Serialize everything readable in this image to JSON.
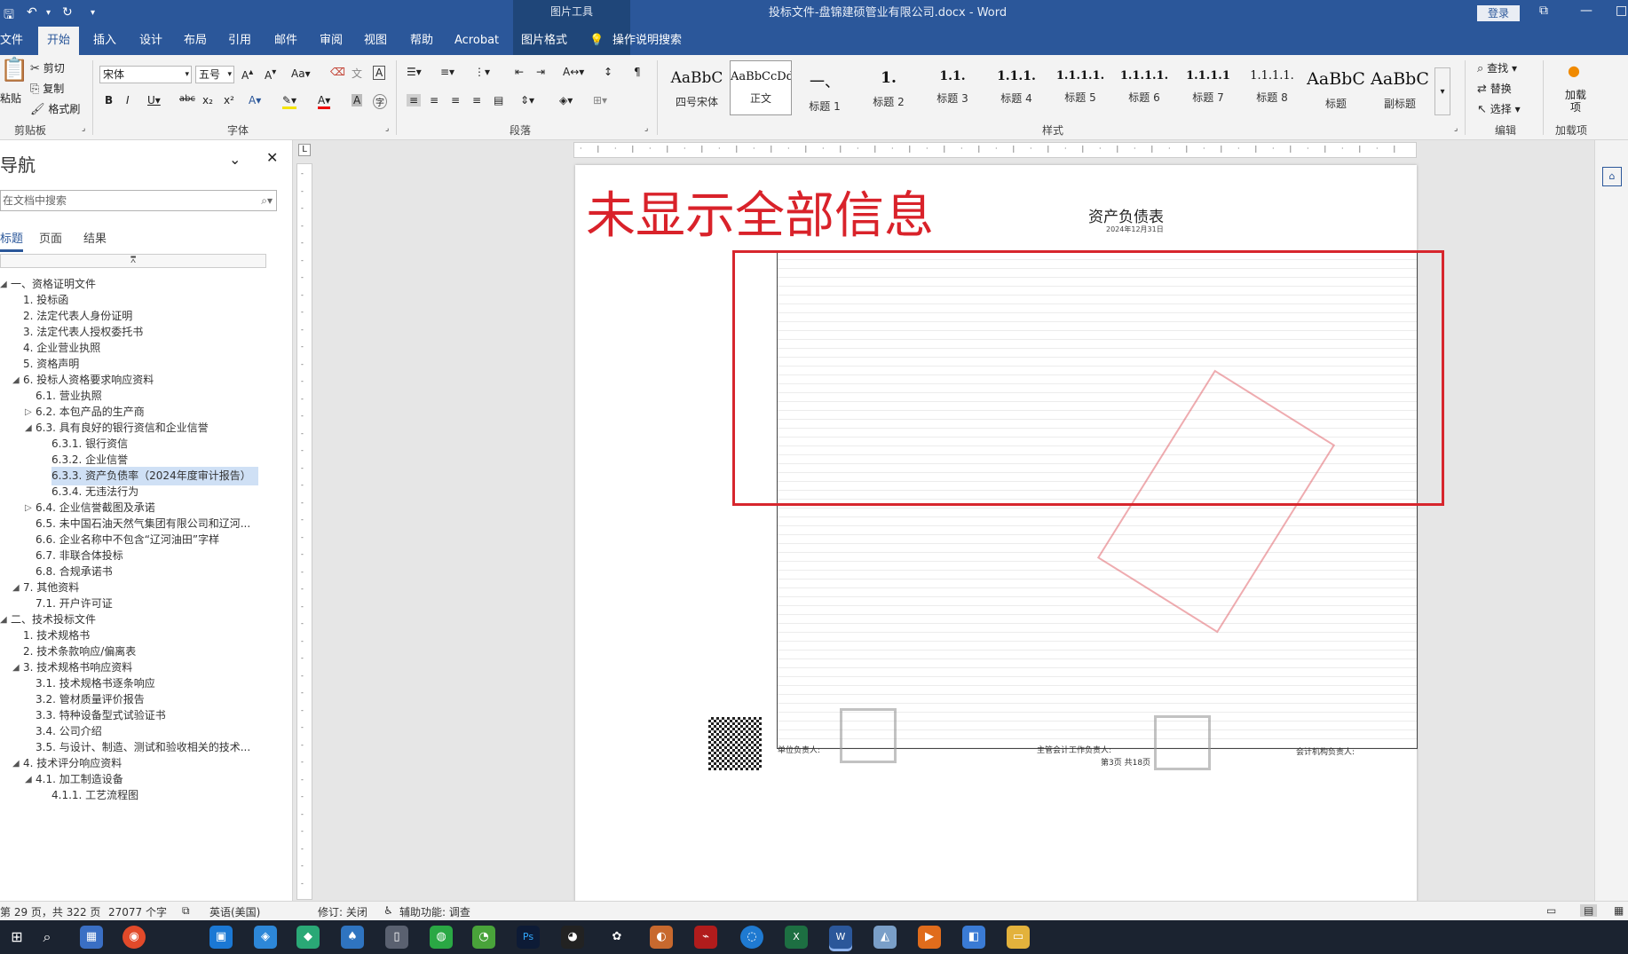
{
  "titlebar": {
    "context_tools": "图片工具",
    "doc_title": "投标文件-盘锦建硕管业有限公司.docx  -  Word",
    "login": "登录"
  },
  "tabs": [
    "文件",
    "开始",
    "插入",
    "设计",
    "布局",
    "引用",
    "邮件",
    "审阅",
    "视图",
    "帮助",
    "Acrobat",
    "图片格式"
  ],
  "search_tell": "操作说明搜索",
  "ribbon": {
    "clipboard": {
      "paste": "粘贴",
      "cut": "剪切",
      "copy": "复制",
      "painter": "格式刷",
      "label": "剪贴板"
    },
    "font": {
      "name": "宋体",
      "size": "五号",
      "label": "字体"
    },
    "paragraph": {
      "label": "段落"
    },
    "styles": {
      "label": "样式",
      "items": [
        {
          "preview": "AaBbC",
          "name": "四号宋体"
        },
        {
          "preview": "AaBbCcDd",
          "name": "正文"
        },
        {
          "preview": "一、",
          "name": "标题 1"
        },
        {
          "preview": "1.",
          "name": "标题 2"
        },
        {
          "preview": "1.1.",
          "name": "标题 3"
        },
        {
          "preview": "1.1.1.",
          "name": "标题 4"
        },
        {
          "preview": "1.1.1.1.",
          "name": "标题 5"
        },
        {
          "preview": "1.1.1.1.",
          "name": "标题 6"
        },
        {
          "preview": "1.1.1.1",
          "name": "标题 7"
        },
        {
          "preview": "1.1.1.1.",
          "name": "标题 8"
        },
        {
          "preview": "AaBbC",
          "name": "标题"
        },
        {
          "preview": "AaBbC",
          "name": "副标题"
        }
      ]
    },
    "editing": {
      "find": "查找",
      "replace": "替换",
      "select": "选择",
      "label": "编辑"
    },
    "addins": {
      "add": "加载项",
      "label": "加载项"
    }
  },
  "nav": {
    "title": "导航",
    "search_placeholder": "在文档中搜索",
    "tabs": [
      "标题",
      "页面",
      "结果"
    ],
    "items": [
      {
        "text": "一、资格证明文件",
        "level": 0,
        "caret": "◢"
      },
      {
        "text": "1. 投标函",
        "level": 1
      },
      {
        "text": "2. 法定代表人身份证明",
        "level": 1
      },
      {
        "text": "3. 法定代表人授权委托书",
        "level": 1
      },
      {
        "text": "4. 企业营业执照",
        "level": 1
      },
      {
        "text": "5. 资格声明",
        "level": 1
      },
      {
        "text": "6. 投标人资格要求响应资料",
        "level": 1,
        "caret": "◢"
      },
      {
        "text": "6.1. 营业执照",
        "level": 2
      },
      {
        "text": "6.2. 本包产品的生产商",
        "level": 2,
        "caret": "▷"
      },
      {
        "text": "6.3. 具有良好的银行资信和企业信誉",
        "level": 2,
        "caret": "◢"
      },
      {
        "text": "6.3.1. 银行资信",
        "level": 3
      },
      {
        "text": "6.3.2. 企业信誉",
        "level": 3
      },
      {
        "text": "6.3.3. 资产负债率（2024年度审计报告）",
        "level": 3,
        "selected": true
      },
      {
        "text": "6.3.4. 无违法行为",
        "level": 3
      },
      {
        "text": "6.4. 企业信誉截图及承诺",
        "level": 2,
        "caret": "▷"
      },
      {
        "text": "6.5. 未中国石油天然气集团有限公司和辽河...",
        "level": 2
      },
      {
        "text": "6.6. 企业名称中不包含“辽河油田”字样",
        "level": 2
      },
      {
        "text": "6.7. 非联合体投标",
        "level": 2
      },
      {
        "text": "6.8. 合规承诺书",
        "level": 2
      },
      {
        "text": "7. 其他资料",
        "level": 1,
        "caret": "◢"
      },
      {
        "text": "7.1. 开户许可证",
        "level": 2
      },
      {
        "text": "二、技术投标文件",
        "level": 0,
        "caret": "◢"
      },
      {
        "text": "1. 技术规格书",
        "level": 1
      },
      {
        "text": "2. 技术条款响应/偏离表",
        "level": 1
      },
      {
        "text": "3. 技术规格书响应资料",
        "level": 1,
        "caret": "◢"
      },
      {
        "text": "3.1. 技术规格书逐条响应",
        "level": 2
      },
      {
        "text": "3.2. 管材质量评价报告",
        "level": 2
      },
      {
        "text": "3.3. 特种设备型式试验证书",
        "level": 2
      },
      {
        "text": "3.4. 公司介绍",
        "level": 2
      },
      {
        "text": "3.5. 与设计、制造、测试和验收相关的技术...",
        "level": 2
      },
      {
        "text": "4. 技术评分响应资料",
        "level": 1,
        "caret": "◢"
      },
      {
        "text": "4.1. 加工制造设备",
        "level": 2,
        "caret": "◢"
      },
      {
        "text": "4.1.1. 工艺流程图",
        "level": 3
      }
    ]
  },
  "document": {
    "annotation": "未显示全部信息",
    "sheet_title": "资产负债表",
    "sheet_date": "2024年12月31日",
    "footer": {
      "left": "单位负责人:",
      "mid": "主管会计工作负责人:",
      "page": "第3页 共18页",
      "right": "会计机构负责人:"
    }
  },
  "status": {
    "page": "第 29 页，共 322 页",
    "words": "27077 个字",
    "lang": "英语(美国)",
    "track": "修订: 关闭",
    "access": "辅助功能: 调查"
  },
  "colors": {
    "brand": "#2b579a",
    "annotation": "#d7262d"
  }
}
